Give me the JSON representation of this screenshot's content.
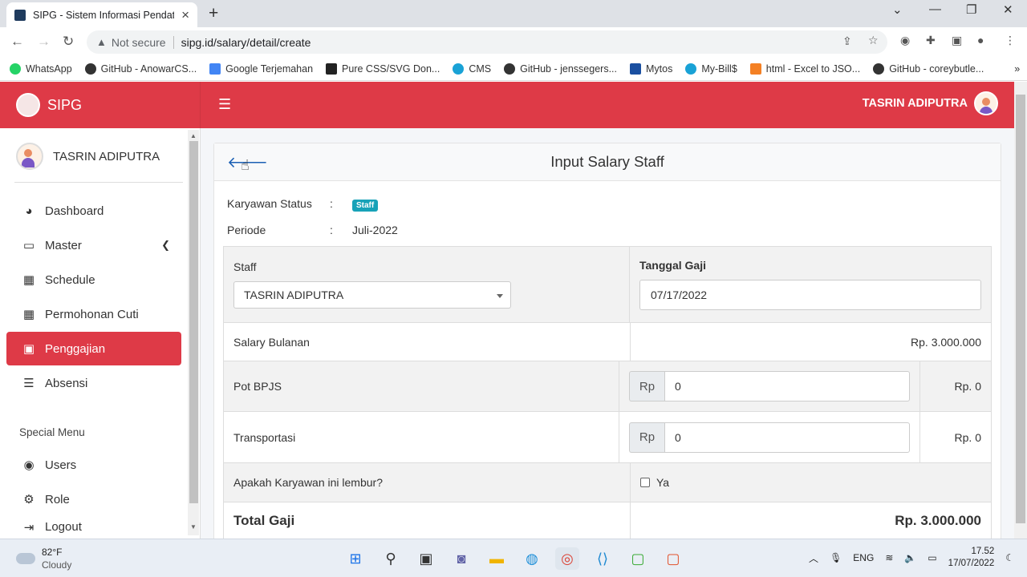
{
  "browser": {
    "tab_title": "SIPG - Sistem Informasi Pendata",
    "not_secure": "Not secure",
    "url": "sipg.id/salary/detail/create"
  },
  "bookmarks": [
    "WhatsApp",
    "GitHub - AnowarCS...",
    "Google Terjemahan",
    "Pure CSS/SVG Don...",
    "CMS",
    "GitHub - jenssegers...",
    "Mytos",
    "My-Bill$",
    "html - Excel to JSO...",
    "GitHub - coreybutle..."
  ],
  "app": {
    "brand": "SIPG",
    "user_name": "TASRIN ADIPUTRA"
  },
  "sidebar": {
    "user_name": "TASRIN ADIPUTRA",
    "items": [
      {
        "label": "Dashboard",
        "icon": "tachometer-icon"
      },
      {
        "label": "Master",
        "icon": "laptop-icon"
      },
      {
        "label": "Schedule",
        "icon": "calendar-icon"
      },
      {
        "label": "Permohonan Cuti",
        "icon": "calendar-icon"
      },
      {
        "label": "Penggajian",
        "icon": "money-icon"
      },
      {
        "label": "Absensi",
        "icon": "list-check-icon"
      }
    ],
    "special_menu_label": "Special Menu",
    "special_items": [
      {
        "label": "Users",
        "icon": "user-circle-icon"
      },
      {
        "label": "Role",
        "icon": "gear-icon"
      },
      {
        "label": "Logout",
        "icon": "logout-icon"
      }
    ]
  },
  "card": {
    "title": "Input Salary Staff",
    "karyawan_status_label": "Karyawan Status",
    "karyawan_status_value": "Staff",
    "periode_label": "Periode",
    "periode_value": "Juli-2022",
    "colon": ":"
  },
  "form": {
    "staff_label": "Staff",
    "staff_value": "TASRIN ADIPUTRA",
    "tanggal_label": "Tanggal Gaji",
    "tanggal_value": "07/17/2022",
    "salary_label": "Salary Bulanan",
    "salary_value": "Rp. 3.000.000",
    "bpjs_label": "Pot BPJS",
    "bpjs_prefix": "Rp",
    "bpjs_value": "0",
    "bpjs_total": "Rp. 0",
    "transport_label": "Transportasi",
    "transport_prefix": "Rp",
    "transport_value": "0",
    "transport_total": "Rp. 0",
    "lembur_label": "Apakah Karyawan ini lembur?",
    "lembur_option": "Ya",
    "total_label": "Total Gaji",
    "total_value": "Rp. 3.000.000"
  },
  "taskbar": {
    "temp": "82°F",
    "weather": "Cloudy",
    "lang": "ENG",
    "time": "17.52",
    "date": "17/07/2022"
  }
}
